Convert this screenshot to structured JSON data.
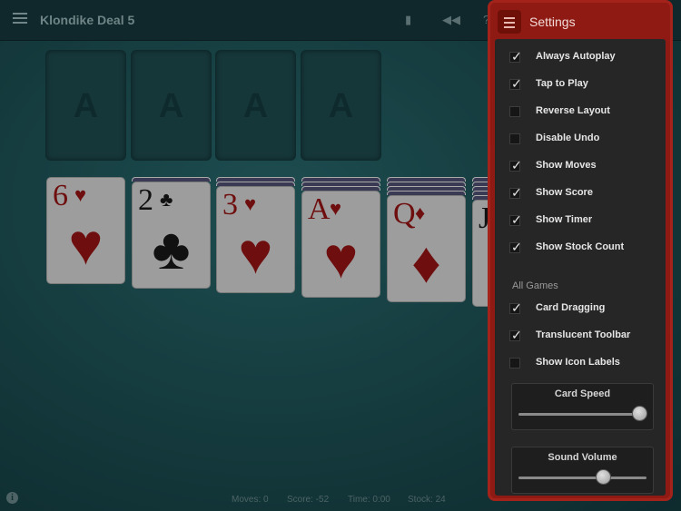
{
  "toolbar": {
    "title": "Klondike Deal 5",
    "icons": [
      "menu-icon",
      "book-icon",
      "rewind-icon",
      "help-icon"
    ]
  },
  "foundations": [
    {
      "label": "A"
    },
    {
      "label": "A"
    },
    {
      "label": "A"
    },
    {
      "label": "A"
    }
  ],
  "tableau": [
    {
      "rank": "6",
      "suit": "♥",
      "color": "#6e0e0e",
      "hidden_count": 0
    },
    {
      "rank": "2",
      "suit": "♣",
      "color": "#111111",
      "hidden_count": 1
    },
    {
      "rank": "3",
      "suit": "♥",
      "color": "#6e0e0e",
      "hidden_count": 2
    },
    {
      "rank": "A",
      "suit": "♥",
      "color": "#6e0e0e",
      "hidden_count": 3
    },
    {
      "rank": "Q",
      "suit": "♦",
      "color": "#6e0e0e",
      "hidden_count": 4
    },
    {
      "rank": "J",
      "suit": "",
      "color": "#111111",
      "hidden_count": 5
    }
  ],
  "status": {
    "moves": "Moves: 0",
    "score": "Score: -52",
    "time": "Time: 0:00",
    "stock": "Stock: 24"
  },
  "settings": {
    "title": "Settings",
    "game_options": [
      {
        "label": "Always Autoplay",
        "checked": true
      },
      {
        "label": "Tap to Play",
        "checked": true
      },
      {
        "label": "Reverse Layout",
        "checked": false
      },
      {
        "label": "Disable Undo",
        "checked": false
      },
      {
        "label": "Show Moves",
        "checked": true
      },
      {
        "label": "Show Score",
        "checked": true
      },
      {
        "label": "Show Timer",
        "checked": true
      },
      {
        "label": "Show Stock Count",
        "checked": true
      }
    ],
    "all_games_heading": "All Games",
    "all_games_options": [
      {
        "label": "Card Dragging",
        "checked": true
      },
      {
        "label": "Translucent Toolbar",
        "checked": true
      },
      {
        "label": "Show Icon Labels",
        "checked": false
      }
    ],
    "sliders": [
      {
        "label": "Card Speed",
        "value": 1.0
      },
      {
        "label": "Sound Volume",
        "value": 0.7
      }
    ],
    "accent_color": "#8e1a13"
  }
}
